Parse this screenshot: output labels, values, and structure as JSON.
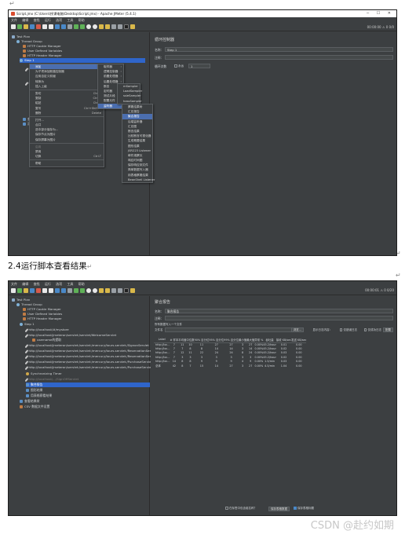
{
  "doc": {
    "caption": "2.4运行脚本查看结果",
    "watermark": "CSDN @赴约如期"
  },
  "window1": {
    "title": "Script.jmx (C:\\Users\\授课电脑\\Desktop\\Script.jmx) - Apache JMeter (5.4.1)",
    "menus": [
      "文件",
      "编辑",
      "查找",
      "运行",
      "选项",
      "工具",
      "帮助"
    ],
    "toolbar_right": "00:00:00  ⚠ 0  0/0",
    "tree": {
      "test_plan": "Test Plan",
      "thread_group": "Thread Group",
      "cookie": "HTTP Cookie Manager",
      "udv": "User Defined Variables",
      "header": "HTTP Header Manager",
      "step": "Step 1",
      "http1": "http://...",
      "http2": "http://...",
      "view_results": "查看结果树",
      "agg": "汇总报告"
    },
    "panel": {
      "title": "循环控制器",
      "name_label": "名称：",
      "name_value": "Step 1",
      "comment_label": "注释：",
      "loop_label": "循环次数",
      "forever_label": "永远",
      "loop_value": "1"
    },
    "context_menu": [
      {
        "label": "添加",
        "hl": true,
        "arrow": true
      },
      {
        "label": "为子项添加断路控制器"
      },
      {
        "label": "应用自定义前缀"
      },
      {
        "label": "转换为",
        "arrow": true
      },
      {
        "label": "插入上级",
        "arrow": true
      },
      {
        "sep": true
      },
      {
        "label": "剪切",
        "sc": "Ctrl-X"
      },
      {
        "label": "复制",
        "sc": "Ctrl-C"
      },
      {
        "label": "粘贴",
        "sc": "Ctrl-V"
      },
      {
        "label": "复写",
        "sc": "Ctrl+Shift-C"
      },
      {
        "label": "删除",
        "sc": "Delete"
      },
      {
        "sep": true
      },
      {
        "label": "打开..."
      },
      {
        "label": "合并"
      },
      {
        "label": "选中部分保存为..."
      },
      {
        "label": "保存节点为图片"
      },
      {
        "label": "保存屏幕为图片"
      },
      {
        "sep": true
      },
      {
        "label": "启用",
        "dis": true
      },
      {
        "label": "禁用"
      },
      {
        "label": "切换",
        "sc": "Ctrl-T"
      },
      {
        "sep": true
      },
      {
        "label": "帮助"
      }
    ],
    "submenu_add": [
      {
        "label": "取样器",
        "arrow": true
      },
      {
        "label": "逻辑控制器",
        "arrow": true
      },
      {
        "label": "前置处理器",
        "arrow": true
      },
      {
        "label": "后置处理器",
        "arrow": true
      },
      {
        "label": "断言",
        "arrow": true
      },
      {
        "label": "定时器",
        "arrow": true
      },
      {
        "label": "测试片段",
        "arrow": true
      },
      {
        "label": "配置元件",
        "arrow": true
      },
      {
        "label": "监听器",
        "arrow": true,
        "hl": true
      }
    ],
    "submenu_sampler": [
      "mSampler",
      "LoadSampler",
      "ssieSampler",
      "hassSampler"
    ],
    "submenu_listener": [
      {
        "label": "察看结果树"
      },
      {
        "label": "汇总报告"
      },
      {
        "label": "聚合报告",
        "hl": true
      },
      {
        "label": "后端监听器"
      },
      {
        "label": "汇总图"
      },
      {
        "label": "断言结果"
      },
      {
        "label": "比较断言可视化器"
      },
      {
        "label": "生成概要结果"
      },
      {
        "label": "图形结果"
      },
      {
        "label": "JSR223 Listener"
      },
      {
        "label": "邮件观察仪"
      },
      {
        "label": "响应时间图"
      },
      {
        "label": "保存响应到文件"
      },
      {
        "label": "简单数据写入器"
      },
      {
        "label": "用表格察看结果"
      },
      {
        "label": "BeanShell Listener"
      }
    ]
  },
  "window2": {
    "menus": [
      "文件",
      "编辑",
      "查找",
      "运行",
      "选项",
      "工具",
      "帮助"
    ],
    "toolbar_right": "00:00:01  ⚠ 0  0/20",
    "tree": {
      "test_plan": "Test Plan",
      "thread_group": "Thread Group",
      "cookie": "HTTP Cookie Manager",
      "udv": "User Defined Variables",
      "header": "HTTP Header Manager",
      "step": "Step 1",
      "req1": "http://localhost/#/mystore",
      "req2": "http://localhost/jmeteron/servlet:/servlet/WelcomeServlet",
      "req2a": "username的提取",
      "req3": "http://localhost/jmeteron/servlet:/servlet:/mercury/tours.servlet:/SignonServlet",
      "req4": "http://localhost/jmeteron/servlet:/servlet:/mercury/tours.servlet:/ReservationServlet",
      "req5": "http://localhost/jmeteron/servlet:/servlet:/mercury/tours.servlet:/ReservationServlet",
      "req6": "http://localhost/jmeteron/servlet:/servlet:/mercury/tours.servlet:/PurchaseServlet",
      "req7": "http://localhost/jmeteron/servlet:/servlet:/mercury/tours.servlet:/PurchaseServlet",
      "timer": "Synchronizing Timer",
      "req8": "http://localhost/.../SignOffServlet",
      "agg": "聚合报告",
      "graph": "图形结果",
      "view": "用表格察看结果",
      "debug": "查看结果树",
      "csv": "CSV 数据文件设置"
    },
    "panel": {
      "title": "聚合报告",
      "name_label": "名称：",
      "name_value": "聚合报告",
      "comment_label": "注释：",
      "write_label": "所有数据写入一个文件",
      "file_label": "文件名",
      "browse": "浏览...",
      "log_label": "显示日志内容：",
      "errors_only": "仅错误日志",
      "success_only": "仅成功日志",
      "configure": "配置",
      "headers": [
        "Label",
        "# 样本",
        "平均值",
        "中位数",
        "90% 百分位",
        "95% 百分位",
        "99% 百分位",
        "最小值",
        "最大值",
        "异常 %",
        "吞吐量",
        "接收 KB/sec",
        "发送 KB/sec"
      ],
      "rows": [
        [
          "http://loc...",
          "7",
          "11",
          "10",
          "11",
          "27",
          "27",
          "3",
          "27",
          "0.00%",
          "45.2/hour",
          "0.01",
          "0.00"
        ],
        [
          "http://loc...",
          "7",
          "7",
          "8",
          "8",
          "14",
          "14",
          "3",
          "14",
          "0.00%",
          "45.2/hour",
          "0.02",
          "0.00"
        ],
        [
          "http://loc...",
          "7",
          "12",
          "11",
          "22",
          "24",
          "24",
          "8",
          "24",
          "0.00%",
          "45.2/hour",
          "0.03",
          "0.00"
        ],
        [
          "http://loc...",
          "7",
          "3",
          "3",
          "3",
          "3",
          "3",
          "3",
          "3",
          "0.00%",
          "45.2/hour",
          "0.02",
          "0.00"
        ],
        [
          "http://loc...",
          "14",
          "8",
          "8",
          "9",
          "9",
          "9",
          "4",
          "9",
          "0.00%",
          "1.5/min",
          "0.03",
          "0.00"
        ],
        [
          "总体",
          "42",
          "8",
          "7",
          "15",
          "14",
          "27",
          "3",
          "27",
          "0.00%",
          "4.5/min",
          "1.04",
          "0.00"
        ]
      ],
      "include_group": "在标签中包含组名称？",
      "save_table": "保存表格数据",
      "save_header": "保存表格标题"
    }
  }
}
